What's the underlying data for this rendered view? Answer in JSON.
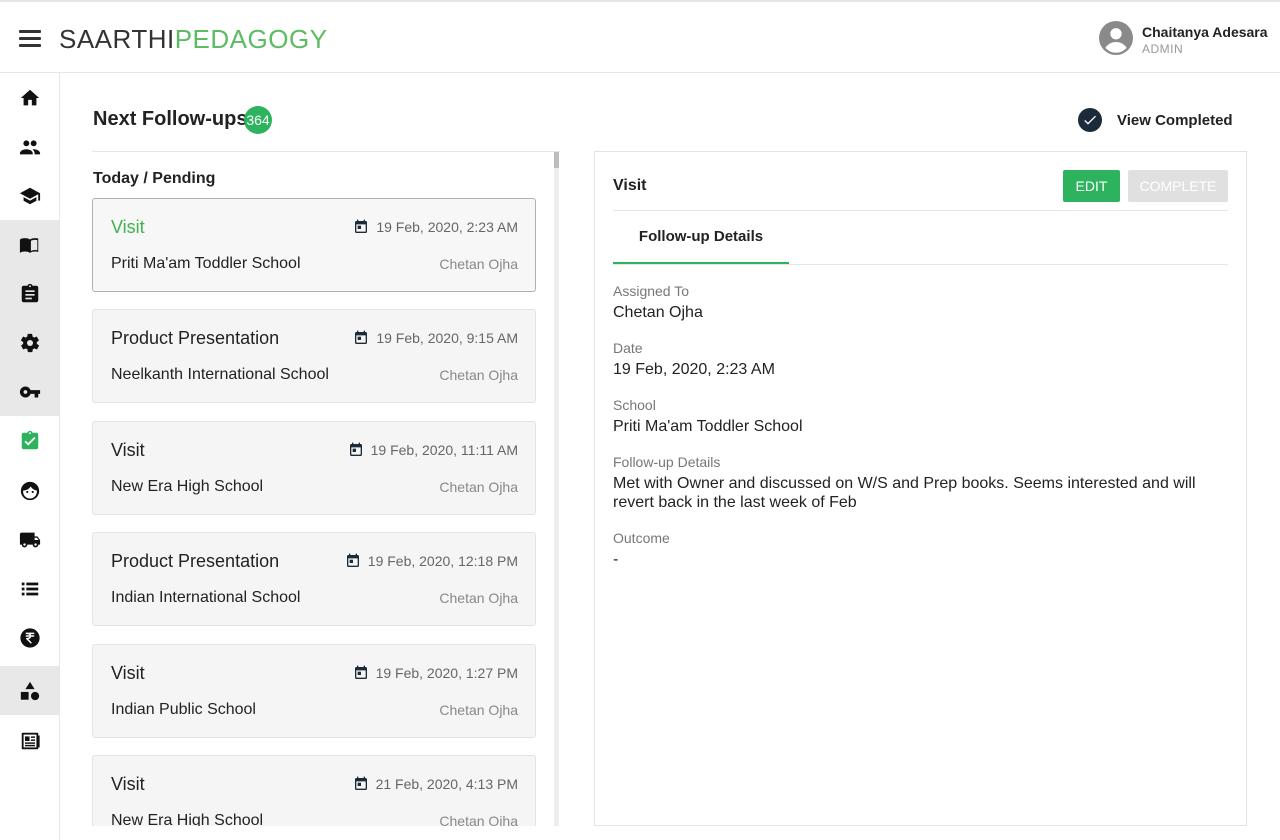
{
  "app": {
    "logo_part1": "SAARTHI",
    "logo_part2": "PEDAGOGY",
    "user_name": "Chaitanya Adesara",
    "user_role": "ADMIN"
  },
  "sidebar": {
    "items": [
      {
        "icon": "home-icon"
      },
      {
        "icon": "people-icon"
      },
      {
        "icon": "school-cap-icon"
      },
      {
        "icon": "book-icon"
      },
      {
        "icon": "clipboard-icon"
      },
      {
        "icon": "gear-icon"
      },
      {
        "icon": "key-icon"
      },
      {
        "icon": "task-check-icon",
        "active": true
      },
      {
        "icon": "face-icon"
      },
      {
        "icon": "truck-icon"
      },
      {
        "icon": "list-icon"
      },
      {
        "icon": "rupee-icon"
      },
      {
        "icon": "shapes-icon"
      },
      {
        "icon": "newspaper-icon"
      }
    ]
  },
  "header": {
    "title": "Next Follow-ups",
    "count": "364",
    "view_completed": "View Completed"
  },
  "list": {
    "section_label": "Today / Pending",
    "items": [
      {
        "type": "Visit",
        "date": "19 Feb, 2020, 2:23 AM",
        "school": "Priti Ma'am Toddler School",
        "owner": "Chetan Ojha"
      },
      {
        "type": "Product Presentation",
        "date": "19 Feb, 2020, 9:15 AM",
        "school": "Neelkanth International School",
        "owner": "Chetan Ojha"
      },
      {
        "type": "Visit",
        "date": "19 Feb, 2020, 11:11 AM",
        "school": "New Era High School",
        "owner": "Chetan Ojha"
      },
      {
        "type": "Product Presentation",
        "date": "19 Feb, 2020, 12:18 PM",
        "school": "Indian International School",
        "owner": "Chetan Ojha"
      },
      {
        "type": "Visit",
        "date": "19 Feb, 2020, 1:27 PM",
        "school": "Indian Public School",
        "owner": "Chetan Ojha"
      },
      {
        "type": "Visit",
        "date": "21 Feb, 2020, 4:13 PM",
        "school": "New Era High School",
        "owner": "Chetan Ojha"
      }
    ]
  },
  "detail": {
    "title": "Visit",
    "edit_label": "EDIT",
    "complete_label": "COMPLETE",
    "tab_label": "Follow-up Details",
    "assigned_label": "Assigned To",
    "assigned_value": "Chetan Ojha",
    "date_label": "Date",
    "date_value": "19 Feb, 2020, 2:23 AM",
    "school_label": "School",
    "school_value": "Priti Ma'am Toddler School",
    "details_label": "Follow-up Details",
    "details_value": "Met with Owner and discussed on W/S and Prep books. Seems interested and will revert back in the last week of Feb",
    "outcome_label": "Outcome",
    "outcome_value": "-"
  },
  "colors": {
    "accent": "#2db35d",
    "logo_green": "#5dbb63",
    "dark": "#1c2b3a"
  }
}
